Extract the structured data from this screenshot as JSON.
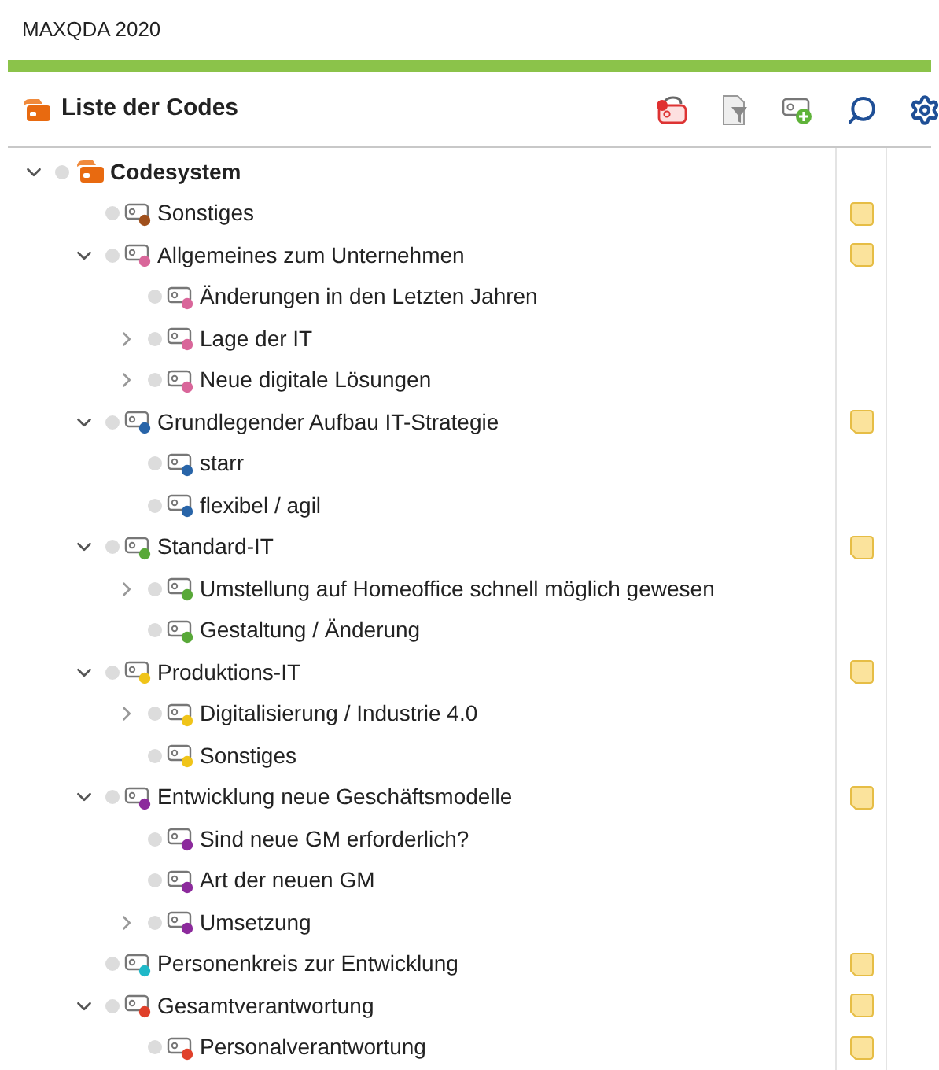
{
  "window": {
    "title": "MAXQDA 2020"
  },
  "panel": {
    "title": "Liste der Codes"
  },
  "toolbar": [
    {
      "kind": "undo-code"
    },
    {
      "kind": "filter"
    },
    {
      "kind": "new-code"
    },
    {
      "kind": "search"
    },
    {
      "kind": "settings"
    }
  ],
  "tree": [
    {
      "label": "Codesystem",
      "kind": "root",
      "expanded": true,
      "memo": false,
      "children": [
        {
          "label": "Sonstiges",
          "color": "#a0501c",
          "memo": true
        },
        {
          "label": "Allgemeines zum Unternehmen",
          "color": "#d9669a",
          "memo": true,
          "expanded": true,
          "children": [
            {
              "label": "Änderungen in den Letzten Jahren",
              "color": "#d9669a",
              "memo": false
            },
            {
              "label": "Lage der IT",
              "color": "#d9669a",
              "memo": false,
              "expanded": false
            },
            {
              "label": "Neue digitale Lösungen",
              "color": "#d9669a",
              "memo": false,
              "expanded": false
            }
          ]
        },
        {
          "label": "Grundlegender Aufbau IT-Strategie",
          "color": "#2864a8",
          "memo": true,
          "expanded": true,
          "children": [
            {
              "label": "starr",
              "color": "#2864a8",
              "memo": false
            },
            {
              "label": "flexibel / agil",
              "color": "#2864a8",
              "memo": false
            }
          ]
        },
        {
          "label": "Standard-IT",
          "color": "#58a838",
          "memo": true,
          "expanded": true,
          "children": [
            {
              "label": "Umstellung auf Homeoffice schnell möglich gewesen",
              "color": "#58a838",
              "memo": false,
              "expanded": false
            },
            {
              "label": "Gestaltung / Änderung",
              "color": "#58a838",
              "memo": false
            }
          ]
        },
        {
          "label": "Produktions-IT",
          "color": "#f0c419",
          "memo": true,
          "expanded": true,
          "children": [
            {
              "label": "Digitalisierung / Industrie 4.0",
              "color": "#f0c419",
              "memo": false,
              "expanded": false
            },
            {
              "label": "Sonstiges",
              "color": "#f0c419",
              "memo": false
            }
          ]
        },
        {
          "label": "Entwicklung neue Geschäftsmodelle",
          "color": "#8c2a9c",
          "memo": true,
          "expanded": true,
          "children": [
            {
              "label": "Sind neue GM erforderlich?",
              "color": "#8c2a9c",
              "memo": false
            },
            {
              "label": "Art der neuen GM",
              "color": "#8c2a9c",
              "memo": false
            },
            {
              "label": "Umsetzung",
              "color": "#8c2a9c",
              "memo": false,
              "expanded": false
            }
          ]
        },
        {
          "label": "Personenkreis zur Entwicklung",
          "color": "#1fb8c8",
          "memo": true
        },
        {
          "label": "Gesamtverantwortung",
          "color": "#e0402a",
          "memo": true,
          "expanded": true,
          "children": [
            {
              "label": "Personalverantwortung",
              "color": "#e0402a",
              "memo": true
            }
          ]
        }
      ]
    }
  ]
}
